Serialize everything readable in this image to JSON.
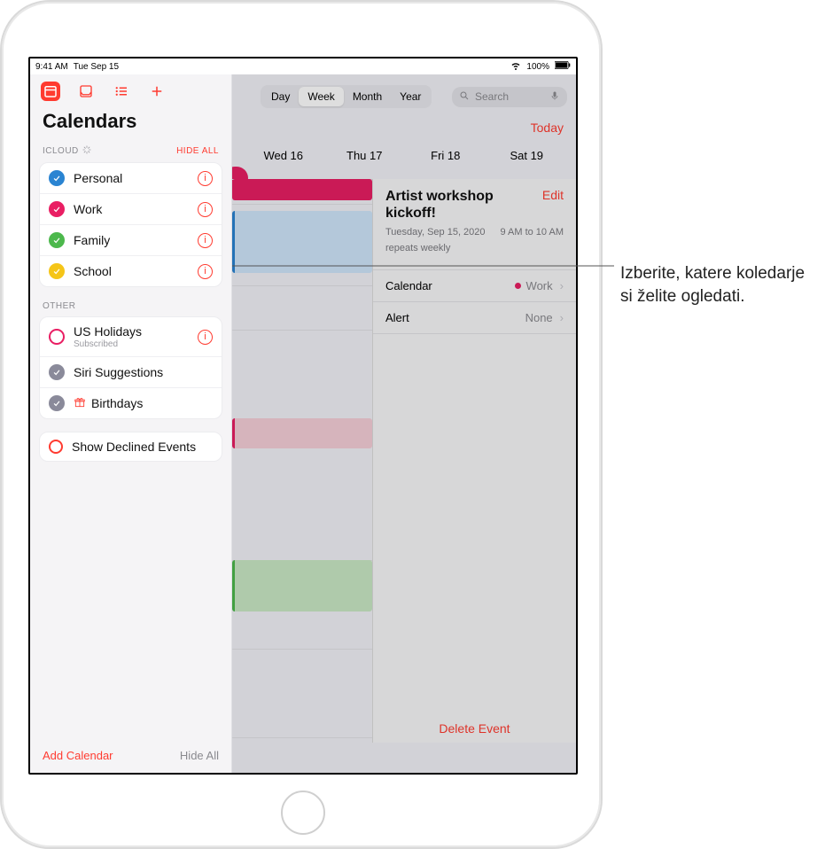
{
  "status": {
    "time": "9:41 AM",
    "date": "Tue Sep 15",
    "battery": "100%"
  },
  "segments": {
    "day": "Day",
    "week": "Week",
    "month": "Month",
    "year": "Year"
  },
  "search_placeholder": "Search",
  "today_label": "Today",
  "days": {
    "wed": "Wed 16",
    "thu": "Thu 17",
    "fri": "Fri 18",
    "sat": "Sat 19"
  },
  "sidebar": {
    "title": "Calendars",
    "section_icloud": "ICLOUD",
    "hide_all_caps": "HIDE ALL",
    "section_other": "OTHER",
    "items": {
      "personal": "Personal",
      "work": "Work",
      "family": "Family",
      "school": "School",
      "us_holidays": "US Holidays",
      "subscribed": "Subscribed",
      "siri": "Siri Suggestions",
      "birthdays": "Birthdays"
    },
    "declined": "Show Declined Events",
    "add_calendar": "Add Calendar",
    "hide_all": "Hide All"
  },
  "event": {
    "edit": "Edit",
    "title": "Artist workshop kickoff!",
    "date": "Tuesday, Sep 15, 2020",
    "time": "9 AM to 10 AM",
    "repeats": "repeats weekly",
    "calendar_label": "Calendar",
    "calendar_value": "Work",
    "alert_label": "Alert",
    "alert_value": "None",
    "delete": "Delete Event"
  },
  "callout": "Izberite, katere koledarje si želite ogledati."
}
